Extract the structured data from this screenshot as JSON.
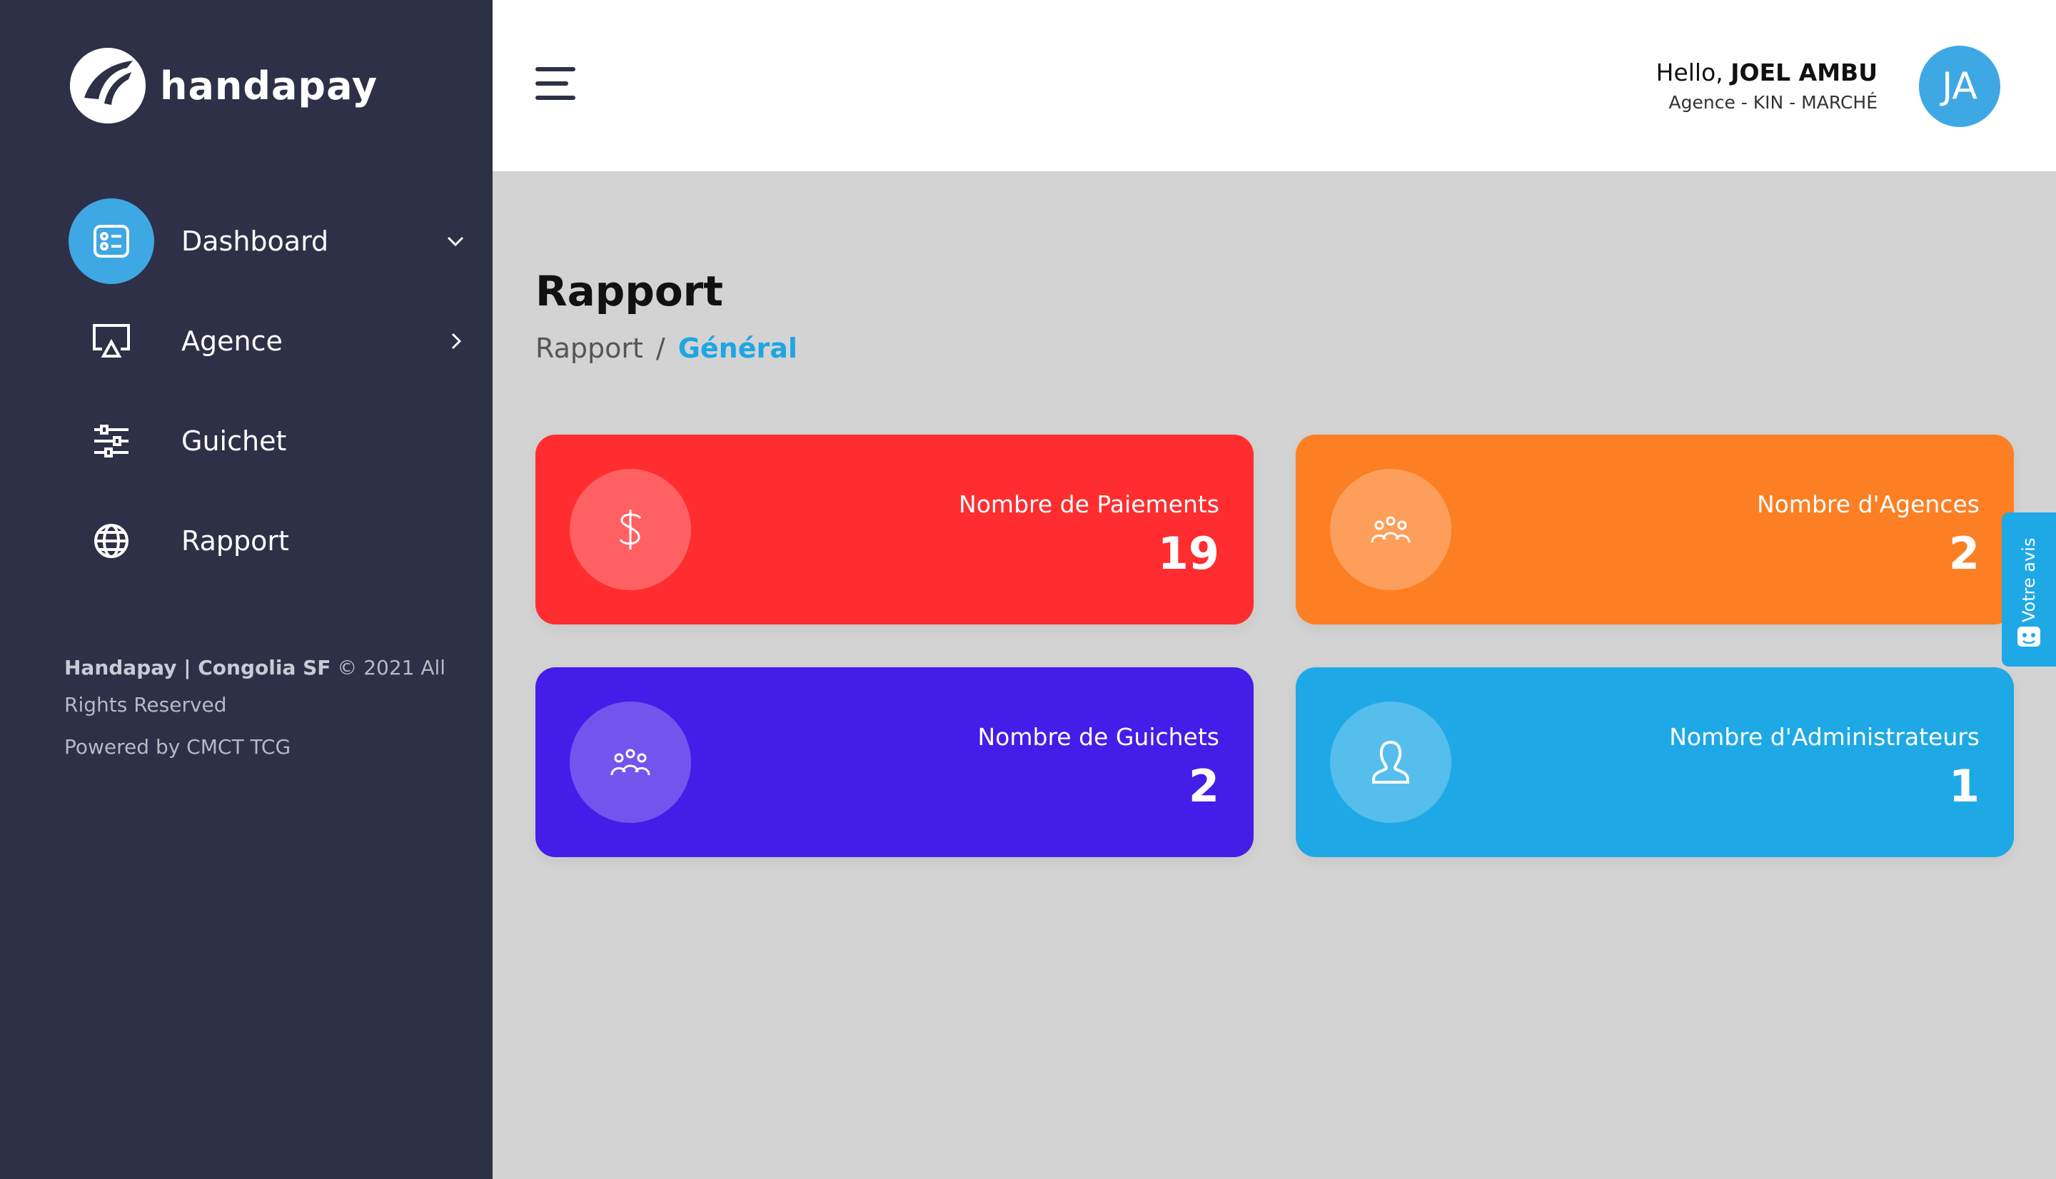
{
  "brand": {
    "name": "handapay"
  },
  "sidebar": {
    "items": [
      {
        "label": "Dashboard",
        "icon": "dashboard-icon",
        "active": true,
        "chevron": "down"
      },
      {
        "label": "Agence",
        "icon": "monitor-icon",
        "active": false,
        "chevron": "right"
      },
      {
        "label": "Guichet",
        "icon": "sliders-icon",
        "active": false
      },
      {
        "label": "Rapport",
        "icon": "globe-icon",
        "active": false
      }
    ],
    "footer_brand": "Handapay | Congolia SF",
    "footer_rights": "© 2021 All Rights Reserved",
    "powered_by": "Powered by CMCT TCG"
  },
  "header": {
    "greeting": "Hello,",
    "user_name": "JOEL AMBU",
    "agency": "Agence - KIN - MARCHÉ",
    "avatar_initials": "JA"
  },
  "page": {
    "title": "Rapport",
    "breadcrumb": [
      "Rapport",
      "/",
      "Général"
    ]
  },
  "cards": [
    {
      "label": "Nombre de Paiements",
      "value": "19",
      "icon": "dollar-icon",
      "color": "#ff2d2f"
    },
    {
      "label": "Nombre d'Agences",
      "value": "2",
      "icon": "group-icon",
      "color": "#fd7f23"
    },
    {
      "label": "Nombre de Guichets",
      "value": "2",
      "icon": "group-icon",
      "color": "#441de9"
    },
    {
      "label": "Nombre d'Administrateurs",
      "value": "1",
      "icon": "user-icon",
      "color": "#1ea9e6"
    }
  ],
  "feedback": {
    "label": "Votre avis"
  },
  "colors": {
    "sidebar": "#2d3047",
    "accent": "#3ea8e4",
    "background": "#d3d3d3"
  }
}
